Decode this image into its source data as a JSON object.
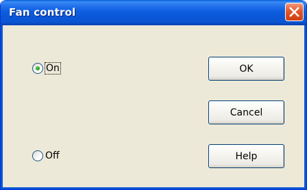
{
  "window": {
    "title": "Fan control"
  },
  "radios": {
    "on_label": "On",
    "off_label": "Off",
    "selected": "On"
  },
  "buttons": {
    "ok": "OK",
    "cancel": "Cancel",
    "help": "Help"
  },
  "colors": {
    "titlebar": "#0a56d6",
    "client_bg": "#ece9d8",
    "close_button": "#e2572b",
    "radio_selected": "#21a121"
  }
}
